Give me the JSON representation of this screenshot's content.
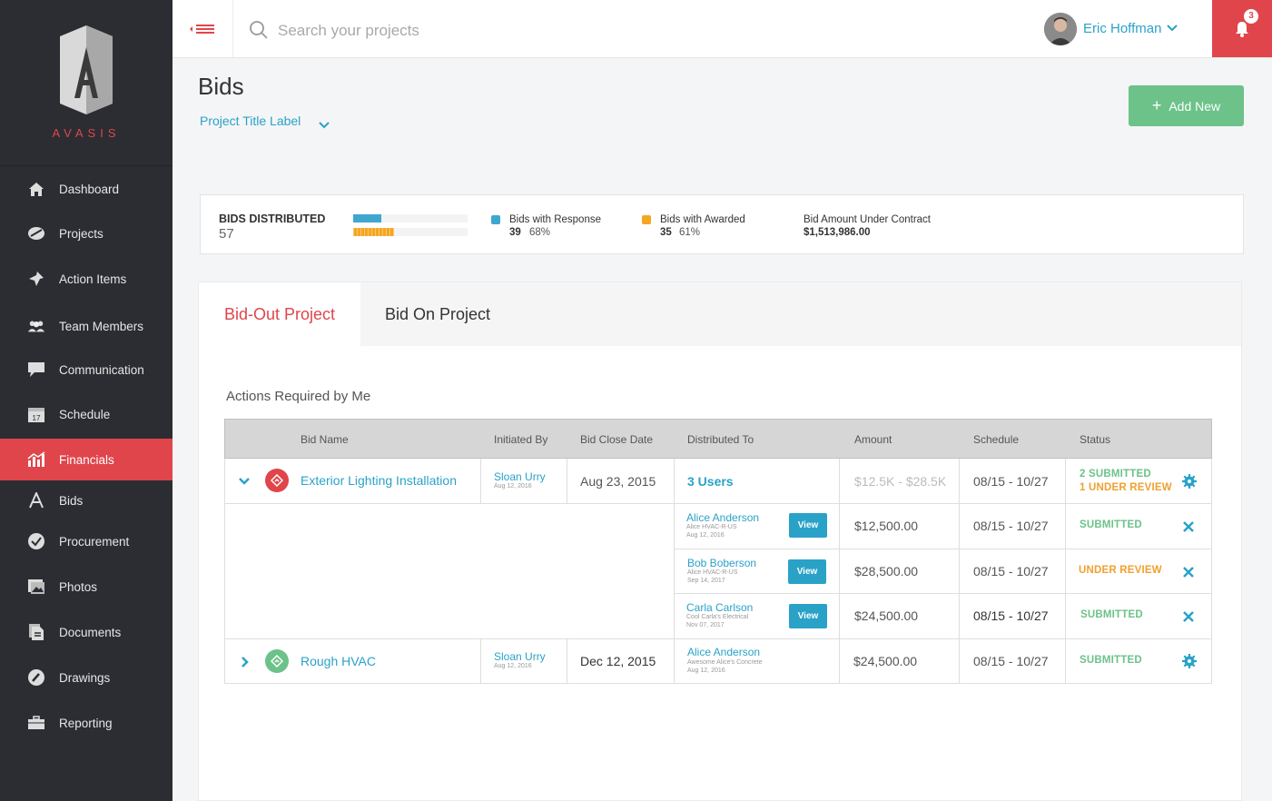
{
  "brand": {
    "name": "AVASIS"
  },
  "sidebar": {
    "items": [
      {
        "label": "Dashboard",
        "icon": "home-icon"
      },
      {
        "label": "Projects",
        "icon": "projects-icon"
      },
      {
        "label": "Action Items",
        "icon": "pin-icon"
      },
      {
        "label": "Team Members",
        "icon": "team-icon"
      },
      {
        "label": "Communication",
        "icon": "chat-icon"
      },
      {
        "label": "Schedule",
        "icon": "calendar-icon",
        "badge": "17"
      },
      {
        "label": "Financials",
        "icon": "chart-icon",
        "active": true
      },
      {
        "label": "Bids",
        "icon": "bids-icon"
      },
      {
        "label": "Procurement",
        "icon": "check-circle-icon"
      },
      {
        "label": "Photos",
        "icon": "photos-icon"
      },
      {
        "label": "Documents",
        "icon": "documents-icon"
      },
      {
        "label": "Drawings",
        "icon": "pencil-icon"
      },
      {
        "label": "Reporting",
        "icon": "briefcase-icon"
      }
    ]
  },
  "topbar": {
    "search_placeholder": "Search your projects",
    "user_name": "Eric Hoffman",
    "notification_count": "3"
  },
  "page": {
    "title": "Bids",
    "project_label": "Project Title Label",
    "add_button": "Add New",
    "add_icon": "+"
  },
  "stats": {
    "distributed_label": "BIDS DISTRIBUTED",
    "distributed_value": "57",
    "response_label": "Bids with Response",
    "response_count": "39",
    "response_pct": "68%",
    "response_fraction": 0.68,
    "awarded_label": "Bids with Awarded",
    "awarded_count": "35",
    "awarded_pct": "61%",
    "awarded_fraction": 0.61,
    "contract_label": "Bid Amount Under Contract",
    "contract_value": "$1,513,986.00",
    "colors": {
      "response": "#3fa7cf",
      "awarded": "#f5a623"
    }
  },
  "tabs": [
    {
      "label": "Bid-Out Project",
      "active": true
    },
    {
      "label": "Bid On Project",
      "active": false
    }
  ],
  "section_title": "Actions Required by Me",
  "table": {
    "headers": [
      "Bid Name",
      "Initiated By",
      "Bid Close Date",
      "Distributed To",
      "Amount",
      "Schedule",
      "Status"
    ],
    "rows": [
      {
        "name": "Exterior Lighting Installation",
        "initiated_by": "Sloan Urry",
        "initiated_date": "Aug 12, 2016",
        "close_date": "Aug 23, 2015",
        "distributed": "3 Users",
        "amount": "$12.5K - $28.5K",
        "schedule": "08/15 - 10/27",
        "status_1": "2 SUBMITTED",
        "status_2": "1 UNDER REVIEW"
      },
      {
        "name": "Rough HVAC",
        "initiated_by": "Sloan Urry",
        "initiated_date": "Aug 12, 2016",
        "close_date": "Dec 12, 2015",
        "distributed": "Alice Anderson",
        "distributed_company": "Awesome Alice's Concrete",
        "distributed_date": "Aug 12, 2016",
        "amount": "$24,500.00",
        "schedule": "08/15 - 10/27",
        "status": "SUBMITTED"
      }
    ],
    "sub_rows": [
      {
        "name": "Alice Anderson",
        "company": "Alice HVAC-R-US",
        "date": "Aug 12, 2016",
        "view": "View",
        "amount": "$12,500.00",
        "schedule": "08/15 - 10/27",
        "status": "SUBMITTED"
      },
      {
        "name": "Bob Boberson",
        "company": "Alice HVAC-R-US",
        "date": "Sep 14, 2017",
        "view": "View",
        "amount": "$28,500.00",
        "schedule": "08/15 - 10/27",
        "status": "UNDER REVIEW"
      },
      {
        "name": "Carla Carlson",
        "company": "Cool Carla's Electrical",
        "date": "Nov 07, 2017",
        "view": "View",
        "amount": "$24,500.00",
        "schedule": "08/15 - 10/27",
        "status": "SUBMITTED"
      }
    ]
  }
}
